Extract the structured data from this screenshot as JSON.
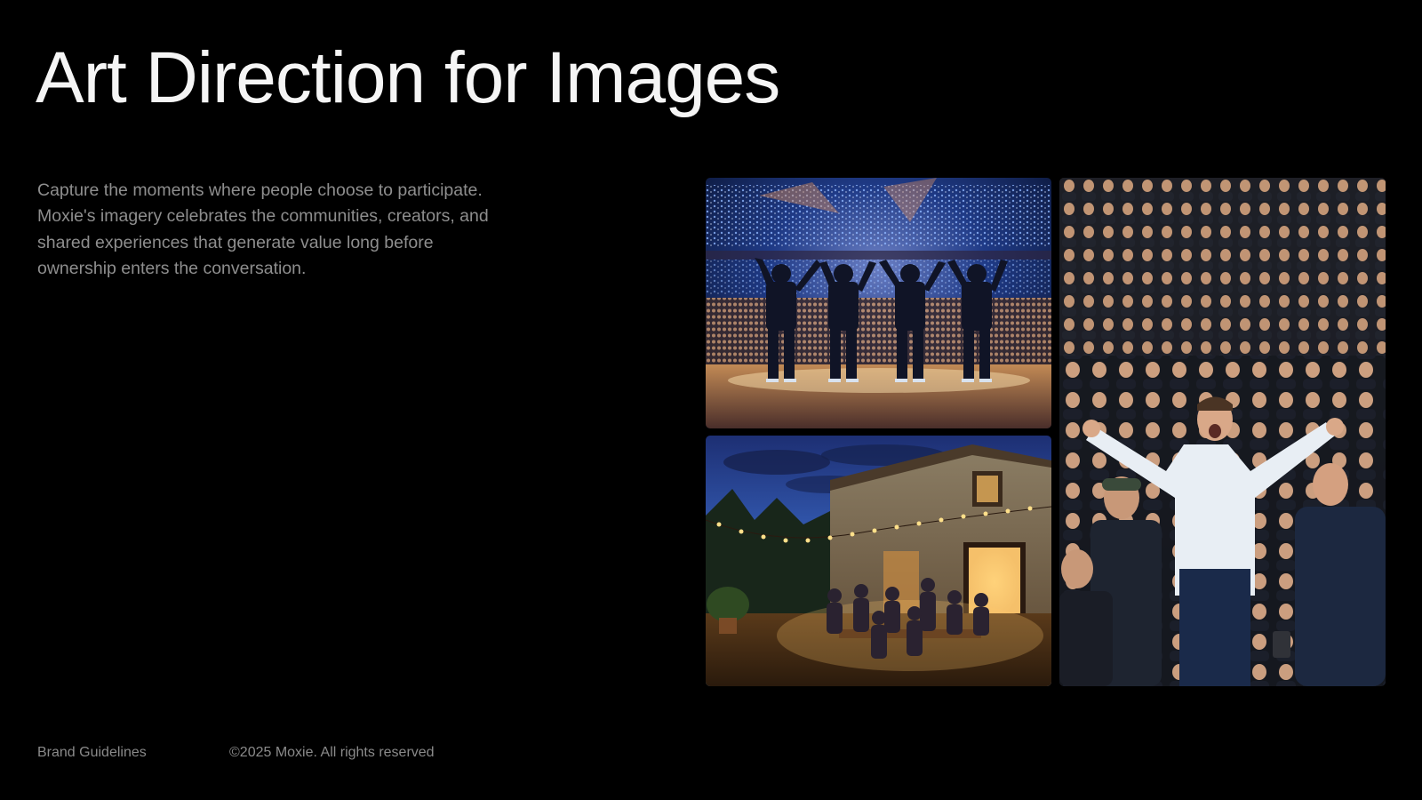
{
  "header": {
    "title": "Art Direction for Images"
  },
  "intro": {
    "lines": [
      "Capture the moments where people choose to participate.",
      "Moxie's imagery celebrates the communities, creators, and",
      "shared experiences that generate value long before",
      "ownership enters the conversation."
    ]
  },
  "gallery": {
    "images": [
      {
        "subject": "concert-stage-photo"
      },
      {
        "subject": "outdoor-dinner-photo"
      },
      {
        "subject": "cheering-crowd-photo"
      }
    ]
  },
  "footer": {
    "left_label": "Brand Guidelines",
    "copyright": "©2025 Moxie. All rights reserved"
  },
  "colors": {
    "background": "#000000",
    "title": "#f5f5f5",
    "body_text": "#8e8e8e",
    "footer_text": "#8a8a8a"
  }
}
